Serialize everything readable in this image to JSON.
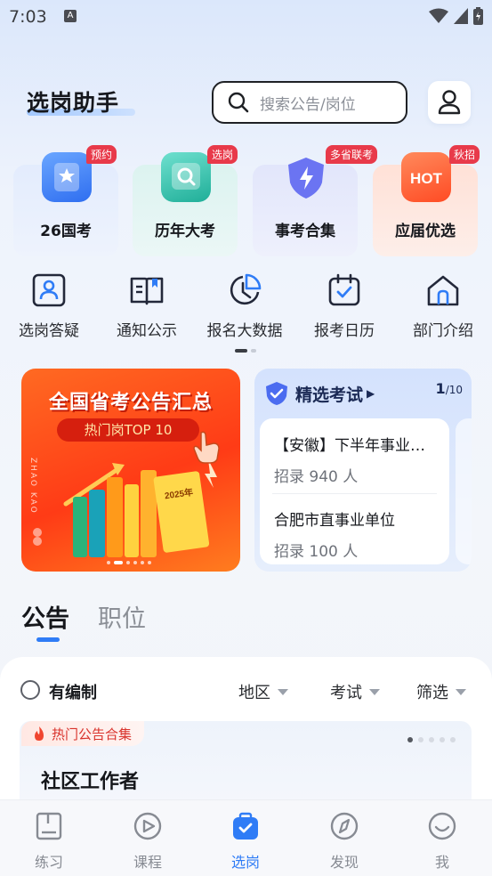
{
  "status_bar": {
    "time": "7:03",
    "notif_badge": "A"
  },
  "header": {
    "title": "选岗助手",
    "search_placeholder": "搜索公告/岗位"
  },
  "categories": [
    {
      "label": "26国考",
      "tag": "预约",
      "icon": "star-card-icon",
      "color": "#3b7cf6"
    },
    {
      "label": "历年大考",
      "tag": "选岗",
      "icon": "search-card-icon",
      "color": "#2fbfa8"
    },
    {
      "label": "事考合集",
      "tag": "多省联考",
      "icon": "lightning-shield-icon",
      "color": "#5f6cf0"
    },
    {
      "label": "应届优选",
      "tag": "秋招",
      "icon": "hot-icon",
      "color": "#ff5a34"
    }
  ],
  "functions": [
    {
      "label": "选岗答疑",
      "icon": "person-card-icon"
    },
    {
      "label": "通知公示",
      "icon": "open-book-icon"
    },
    {
      "label": "报名大数据",
      "icon": "pie-chart-icon"
    },
    {
      "label": "报考日历",
      "icon": "calendar-check-icon"
    },
    {
      "label": "部门介绍",
      "icon": "building-icon"
    }
  ],
  "banner": {
    "title": "全国省考公告汇总",
    "pill": "热门岗TOP 10",
    "side_text": "ZHAO KAO",
    "book_text": "2025年"
  },
  "featured_exams": {
    "title": "精选考试",
    "page_current": "1",
    "page_total": "/10",
    "items": [
      {
        "name": "【安徽】下半年事业单位",
        "count": "招录 940 人"
      },
      {
        "name": "合肥市直事业单位",
        "count": "招录 100 人"
      }
    ]
  },
  "tabs": [
    {
      "label": "公告",
      "active": true
    },
    {
      "label": "职位",
      "active": false
    }
  ],
  "filters": {
    "checkbox_label": "有编制",
    "region": "地区",
    "exam": "考试",
    "filter": "筛选"
  },
  "hot_card": {
    "badge": "热门公告合集",
    "title": "社区工作者"
  },
  "bottom_nav": [
    {
      "label": "练习",
      "icon": "book-icon",
      "active": false
    },
    {
      "label": "课程",
      "icon": "play-icon",
      "active": false
    },
    {
      "label": "选岗",
      "icon": "briefcase-check-icon",
      "active": true
    },
    {
      "label": "发现",
      "icon": "compass-icon",
      "active": false
    },
    {
      "label": "我",
      "icon": "smile-icon",
      "active": false
    }
  ]
}
